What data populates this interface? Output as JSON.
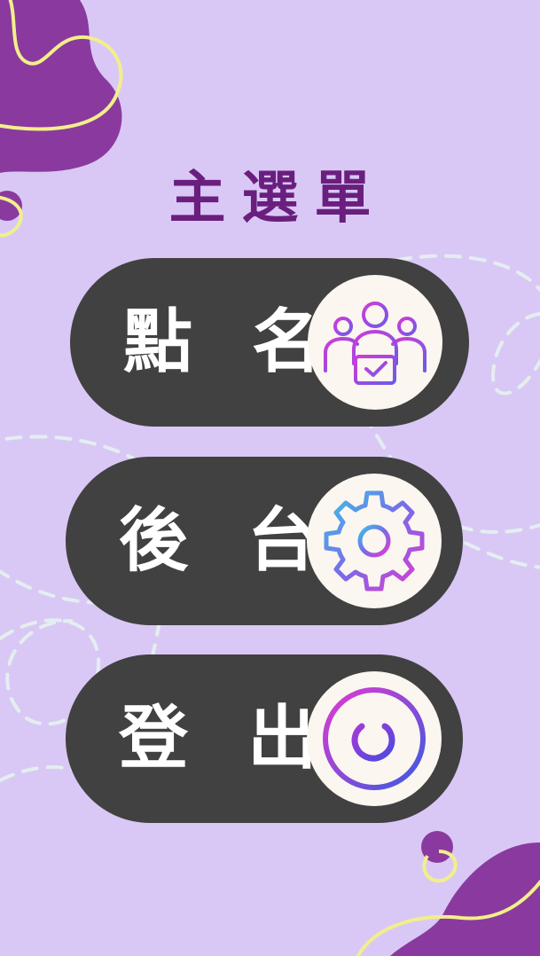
{
  "app": {
    "title": "主選單"
  },
  "menu": {
    "items": [
      {
        "id": "attendance",
        "label": "點 名",
        "icon": "people-check-icon"
      },
      {
        "id": "backend",
        "label": "後 台",
        "icon": "gear-icon"
      },
      {
        "id": "logout",
        "label": "登 出",
        "icon": "power-icon"
      }
    ]
  },
  "colors": {
    "background": "#d9c8f5",
    "title": "#6a1f7e",
    "button": "#414141",
    "icon_circle": "#fbf6ef",
    "blob": "#8a3a9e",
    "squiggle": "#f2ef8a",
    "dashed": "#e4eef0"
  }
}
